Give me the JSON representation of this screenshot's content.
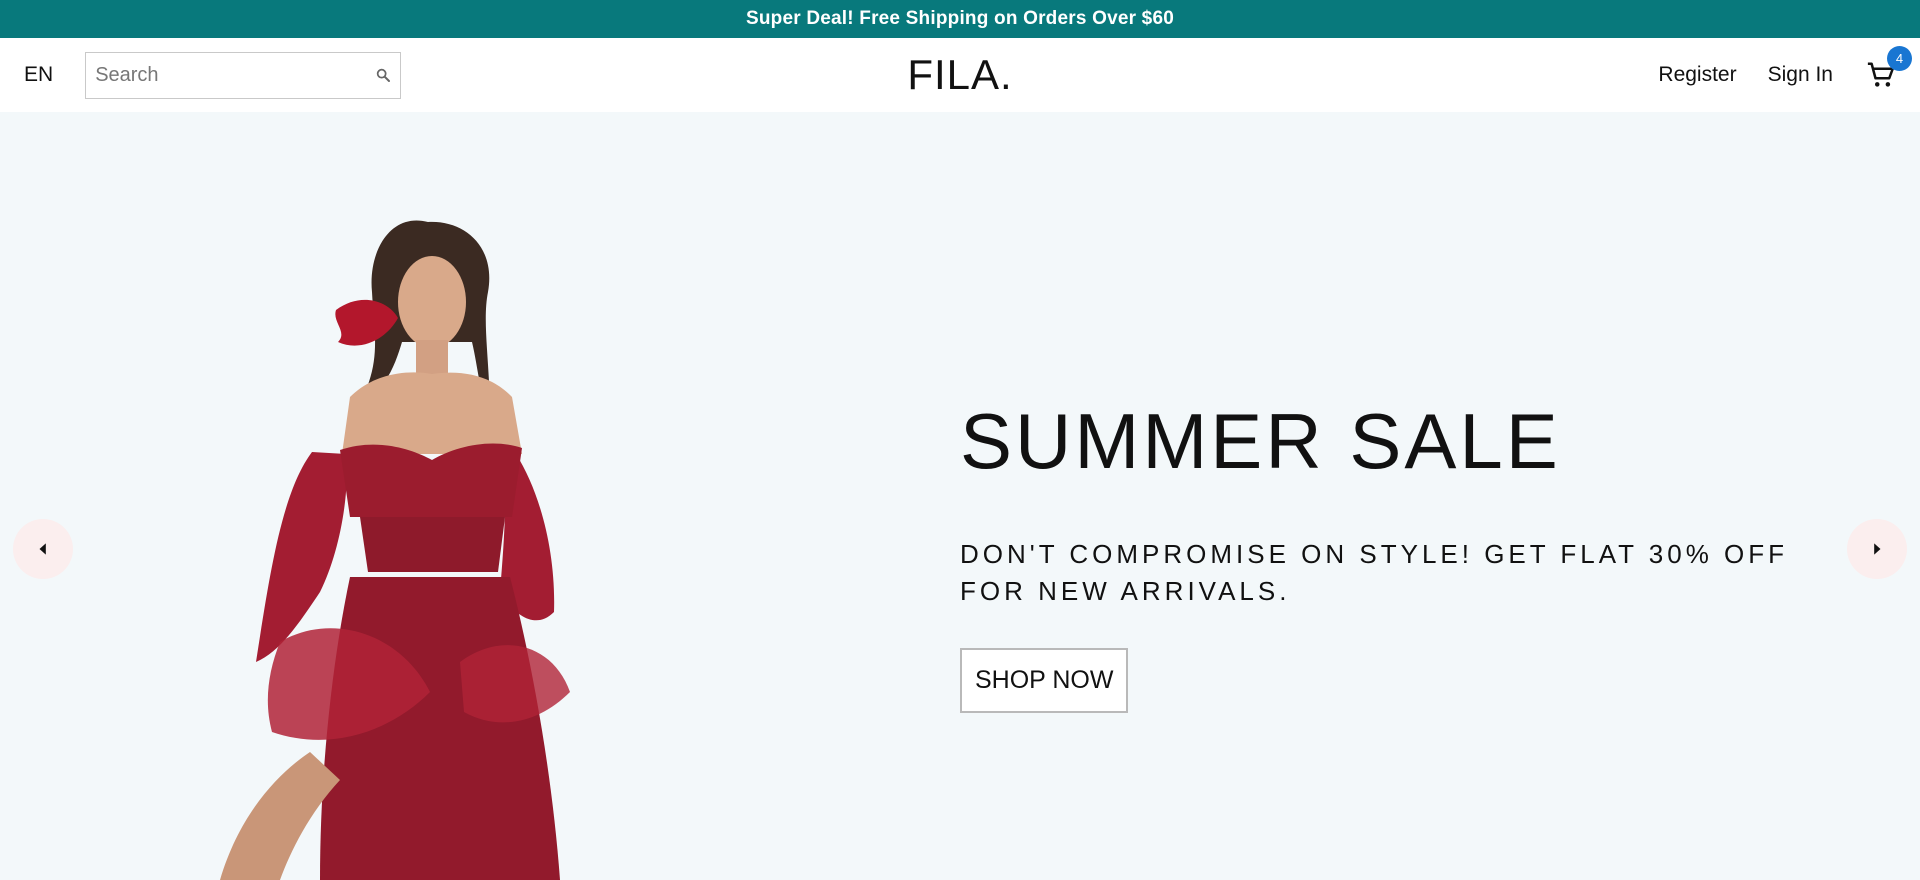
{
  "announcement": {
    "text": "Super Deal! Free Shipping on Orders Over $60"
  },
  "navbar": {
    "language": "EN",
    "search": {
      "placeholder": "Search",
      "value": "",
      "icon": "search-icon"
    },
    "logo": "FILA.",
    "links": {
      "register": "Register",
      "sign_in": "Sign In"
    },
    "cart": {
      "icon": "shopping-cart-icon",
      "count": "4"
    }
  },
  "hero": {
    "title": "SUMMER SALE",
    "description": "DON'T COMPROMISE ON STYLE! GET FLAT 30% OFF FOR NEW ARRIVALS.",
    "cta": "SHOP NOW",
    "background": "#f3f8fa",
    "prev_icon": "arrow-left-icon",
    "next_icon": "arrow-right-icon"
  },
  "colors": {
    "announcement_bg": "#08797c",
    "badge": "#1976d2",
    "dress": "#9b1c2e",
    "arrow_bg": "#fbeeee"
  }
}
